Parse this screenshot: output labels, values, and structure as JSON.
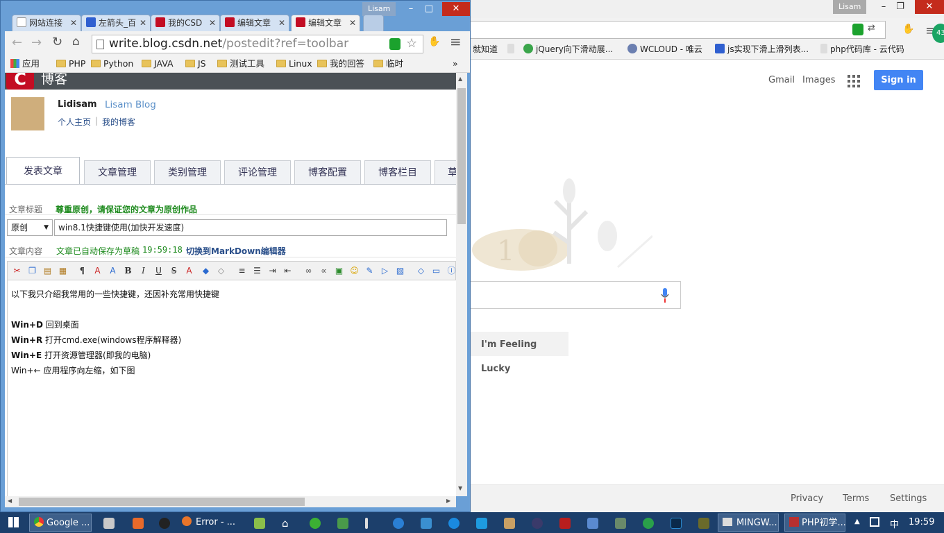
{
  "background_browser": {
    "profile": "Lisam",
    "bookmarks": [
      "就知道",
      "jQuery向下滑动展...",
      "WCLOUD - 唯云",
      "js实现下滑上滑列表...",
      "php代码库 - 云代码"
    ],
    "header_links": [
      "Gmail",
      "Images"
    ],
    "sign_in": "Sign in",
    "lucky_button": "I'm Feeling Lucky",
    "footer": [
      "Privacy",
      "Terms",
      "Settings"
    ],
    "badge": "43"
  },
  "front_window": {
    "profile": "Lisam",
    "tabs": [
      "网站连接",
      "左箭头_百",
      "我的CSD",
      "编辑文章",
      "编辑文章"
    ],
    "url_host": "write.blog.csdn.net",
    "url_path": "/postedit?ref=toolbar",
    "bookmarks": [
      "应用",
      "PHP",
      "Python",
      "JAVA",
      "JS",
      "测试工具",
      "Linux",
      "我的回答",
      "临时"
    ],
    "more": "»"
  },
  "page": {
    "site_title": "博客",
    "username": "Lidisam",
    "blog_name": "Lisam Blog",
    "home_link": "个人主页",
    "sep": "|",
    "blog_link": "我的博客",
    "nav_tabs": [
      "发表文章",
      "文章管理",
      "类别管理",
      "评论管理",
      "博客配置",
      "博客栏目",
      "草"
    ],
    "title_label": "文章标题",
    "title_hint": "尊重原创，请保证您的文章为原创作品",
    "type_select": "原创",
    "title_value": "win8.1快捷键使用(加快开发速度)",
    "content_label": "文章内容",
    "autosave": "文章已自动保存为草稿",
    "autosave_time": "19:59:18",
    "markdown_link": "切换到MarkDown编辑器",
    "editor_lines": [
      {
        "bold": "",
        "text": "以下我只介绍我常用的一些快捷键，还因补充常用快捷键"
      },
      {
        "bold": "Win+D",
        "text": " 回到桌面"
      },
      {
        "bold": "Win+R",
        "text": " 打开cmd.exe(windows程序解释器)"
      },
      {
        "bold": "Win+E",
        "text": " 打开资源管理器(即我的电脑)"
      },
      {
        "bold": "",
        "text": "Win+← 应用程序向左缩，如下图"
      }
    ]
  },
  "taskbar": {
    "items": [
      "Google ...",
      "Error - ...",
      "MINGW...",
      "PHP初学..."
    ],
    "ime": "中",
    "time": "19:59"
  }
}
